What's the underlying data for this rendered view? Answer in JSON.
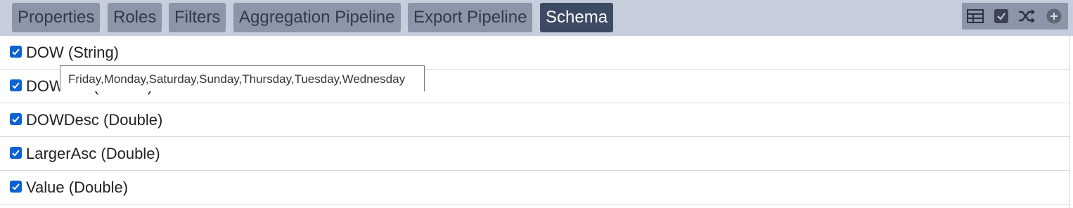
{
  "tabs": [
    {
      "label": "Properties",
      "active": false
    },
    {
      "label": "Roles",
      "active": false
    },
    {
      "label": "Filters",
      "active": false
    },
    {
      "label": "Aggregation Pipeline",
      "active": false
    },
    {
      "label": "Export Pipeline",
      "active": false
    },
    {
      "label": "Schema",
      "active": true
    }
  ],
  "toolbar": {
    "icons": [
      "table-icon",
      "check-square-icon",
      "shuffle-icon",
      "add-circle-icon"
    ]
  },
  "fields": [
    {
      "label": "DOW (String)",
      "checked": true
    },
    {
      "label": "DOWAsc (Double)",
      "checked": true
    },
    {
      "label": "DOWDesc (Double)",
      "checked": true
    },
    {
      "label": "LargerAsc (Double)",
      "checked": true
    },
    {
      "label": "Value (Double)",
      "checked": true
    }
  ],
  "tooltip": {
    "text": "Friday,Monday,Saturday,Sunday,Thursday,Tuesday,Wednesday"
  },
  "colors": {
    "topbar_bg": "#c6cedb",
    "tab_bg": "#8b96a9",
    "tab_active_bg": "#3c4a63",
    "checkbox_blue": "#0b63d1"
  }
}
